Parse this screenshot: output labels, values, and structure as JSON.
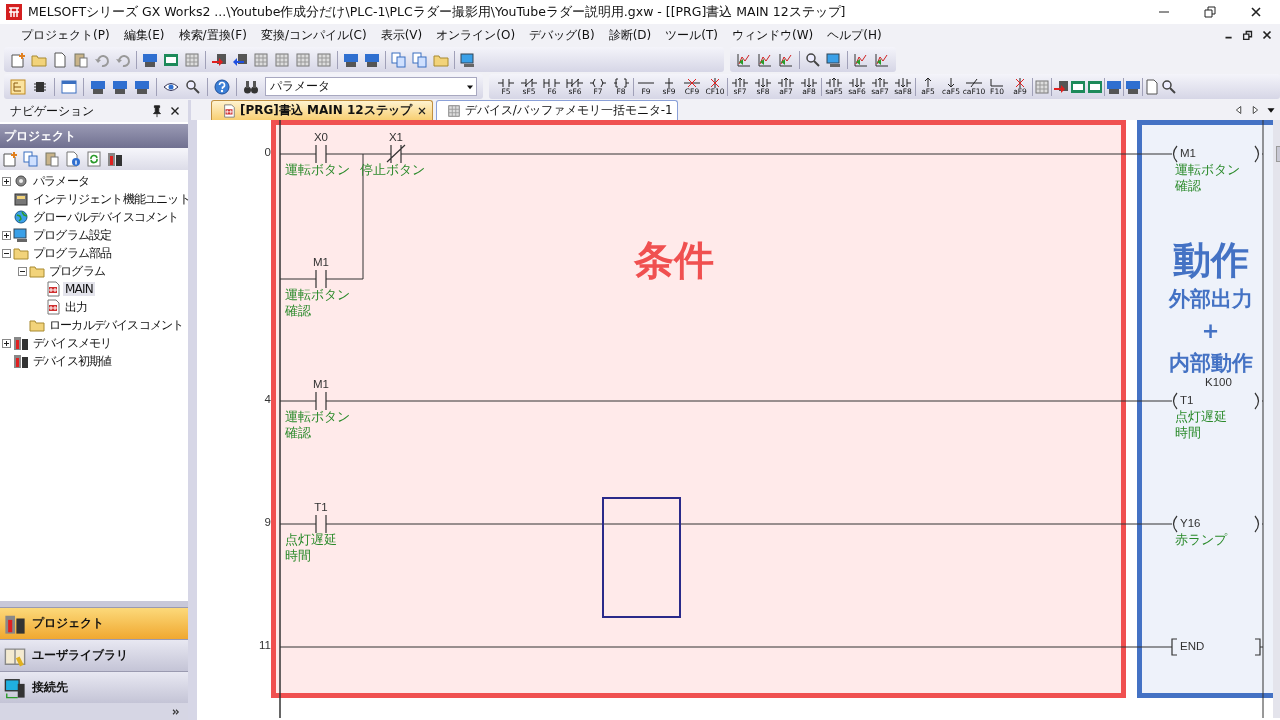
{
  "window": {
    "title": "MELSOFTシリーズ GX Works2 ...\\Youtube作成分だけ\\PLC-1\\PLCラダー撮影用\\YouTubeラダー説明用.gxw - [[PRG]書込 MAIN 12ステップ]"
  },
  "menu": [
    "プロジェクト(P)",
    "編集(E)",
    "検索/置換(F)",
    "変換/コンパイル(C)",
    "表示(V)",
    "オンライン(O)",
    "デバッグ(B)",
    "診断(D)",
    "ツール(T)",
    "ウィンドウ(W)",
    "ヘルプ(H)"
  ],
  "toolbar": {
    "dropdown": {
      "value": "パラメータ"
    },
    "function_keys": [
      "F5",
      "sF5",
      "F6",
      "sF6",
      "F7",
      "F8",
      "F9",
      "sF9",
      "CF9",
      "CF10",
      "sF7",
      "sF8",
      "aF7",
      "aF8",
      "saF5",
      "saF6",
      "saF7",
      "saF8",
      "aF5",
      "caF5",
      "caF10",
      "F10",
      "aF9"
    ]
  },
  "navigation": {
    "title": "ナビゲーション",
    "section": "プロジェクト",
    "tree": [
      {
        "label": "パラメータ",
        "expanded": false,
        "selected": false
      },
      {
        "label": "インテリジェント機能ユニット",
        "selected": false
      },
      {
        "label": "グローバルデバイスコメント",
        "selected": false
      },
      {
        "label": "プログラム設定",
        "expanded": false,
        "selected": false
      },
      {
        "label": "プログラム部品",
        "expanded": true,
        "selected": false,
        "children": [
          {
            "label": "プログラム",
            "expanded": true,
            "selected": false,
            "children": [
              {
                "label": "MAIN",
                "selected": true
              },
              {
                "label": "出力",
                "selected": false
              }
            ]
          },
          {
            "label": "ローカルデバイスコメント",
            "selected": false
          }
        ]
      },
      {
        "label": "デバイスメモリ",
        "expanded": false,
        "selected": false
      },
      {
        "label": "デバイス初期値",
        "selected": false
      }
    ],
    "buttons": [
      {
        "label": "プロジェクト",
        "selected": true
      },
      {
        "label": "ユーザライブラリ",
        "selected": false
      },
      {
        "label": "接続先",
        "selected": false
      }
    ]
  },
  "tabs": [
    {
      "label": "[PRG]書込 MAIN 12ステップ",
      "selected": true
    },
    {
      "label": "デバイス/バッファメモリ一括モニタ-1",
      "selected": false
    }
  ],
  "ladder": {
    "rungs": [
      {
        "step": "0",
        "contacts": [
          {
            "kind": "no",
            "device": "X0",
            "comment": [
              "運転ボタン"
            ]
          },
          {
            "kind": "nc",
            "device": "X1",
            "comment": [
              "停止ボタン"
            ]
          }
        ],
        "branch": [
          {
            "kind": "no",
            "device": "M1",
            "comment": [
              "運転ボタン",
              "確認"
            ]
          }
        ],
        "coil": {
          "kind": "out",
          "device": "M1",
          "comment": [
            "運転ボタン",
            "確認"
          ]
        }
      },
      {
        "step": "4",
        "contacts": [
          {
            "kind": "no",
            "device": "M1",
            "comment": [
              "運転ボタン",
              "確認"
            ]
          }
        ],
        "coil": {
          "kind": "out",
          "device": "T1",
          "setting": "K100",
          "comment": [
            "点灯遅延",
            "時間"
          ]
        }
      },
      {
        "step": "9",
        "contacts": [
          {
            "kind": "no",
            "device": "T1",
            "comment": [
              "点灯遅延",
              "時間"
            ]
          }
        ],
        "coil": {
          "kind": "out",
          "device": "Y16",
          "comment": [
            "赤ランプ"
          ]
        }
      },
      {
        "step": "11",
        "coil": {
          "kind": "end",
          "device": "END"
        }
      }
    ]
  },
  "annotations": {
    "condition": "条件",
    "action": {
      "title": "動作",
      "lines": [
        "外部出力",
        "+",
        "内部動作"
      ]
    }
  }
}
